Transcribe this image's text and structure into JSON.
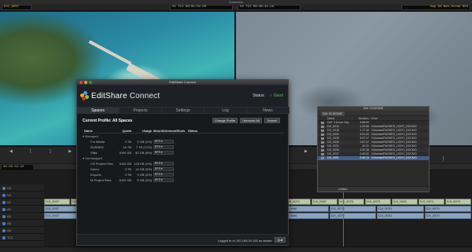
{
  "composer": {
    "title": "Composer",
    "clip_left": "DJI_0037",
    "tc_left": "V1  TC1     00:01:51:00",
    "tc_right": "V2  TC1     00:36:41:18",
    "clip_right": "Day 04 Ben Drone 004"
  },
  "timeline": {
    "timecode": "00:00:02:22",
    "tracks": [
      "V3",
      "V2",
      "V1",
      "A1",
      "A2",
      "A3",
      "A4",
      "TC1"
    ],
    "video_clips": [
      "DJI_0037",
      "DJI_0037",
      "DJI_0037",
      "DJI_0061",
      "DJI_0069",
      "DJI_0071",
      "DJI_0069",
      "DJI_0073",
      "DJI_0066",
      "DJI_0071",
      "DJI_0067",
      "DJI_0075",
      "DJI_0073",
      "DJI_0031",
      "DJI_0071",
      "DJI_0070"
    ],
    "audio_clips": [
      "DJI_0037",
      "DJI_0069",
      "DJI_0071",
      "DJI_0069",
      "DJI_0073",
      "DJI_0066",
      "DJI_0075",
      "DJI_0031",
      "DJI_0070"
    ],
    "footer_label": "untitled"
  },
  "dialog": {
    "title": "EditShare Connect",
    "logo_a": "EditShare",
    "logo_b": " Connect",
    "status_label": "Status:",
    "status_value": "✓ Good",
    "tabs": [
      "Spaces",
      "Projects",
      "Settings",
      "Log",
      "News"
    ],
    "profile_label": "Current Profile: All Spaces",
    "buttons": {
      "change_profile": "Change Profile",
      "unmount_all": "Unmount All",
      "search": "Search"
    },
    "columns": [
      "Name",
      "Quota",
      "Usage",
      "Mount/Unmount",
      "Tools",
      "Status"
    ],
    "groups": {
      "managed": "Managed",
      "unmanaged": "Unmanaged"
    },
    "managed_rows": [
      {
        "name": "For Media",
        "quota": "3 TB",
        "usage": "2 GB (0%)",
        "mount": "EFS"
      },
      {
        "name": "RUSHES",
        "quota": "16 TB",
        "usage": "7 TB (71%)",
        "mount": "EFS"
      },
      {
        "name": "Stills",
        "quota": "1000 GB",
        "usage": "82 GB (8%)",
        "mount": "EFS"
      }
    ],
    "unmanaged_rows": [
      {
        "name": "CS Project Files",
        "quota": "1000 GB",
        "usage": "128 KB (0%)",
        "mount": "EFS"
      },
      {
        "name": "Demo",
        "quota": "3 TB",
        "usage": "14 GB (0%)",
        "mount": "EFS"
      },
      {
        "name": "Exports",
        "quota": "3 TB",
        "usage": "9 GB (0%)",
        "mount": "EFS"
      },
      {
        "name": "M Project Files",
        "quota": "1000 GB",
        "usage": "9 GB (0%)",
        "mount": "EFS"
      }
    ],
    "login_text": "Logged in to 192.168.20.100 as xsuser",
    "quit_label": "Quit"
  },
  "bin": {
    "title": "DAY 03 DRONE",
    "tab_label": "DAY 03 DRONE",
    "columns": [
      "Name",
      "Duration",
      "Drive"
    ],
    "rows": [
      {
        "name": "DAY 3 Drone Seq",
        "duration": "4:58:05",
        "drive": ""
      },
      {
        "name": "DJI_0010",
        "duration": "1:20:08",
        "drive": "/Volumes/RUSHES_LIGHT_DOCMO"
      },
      {
        "name": "DJI_0018",
        "duration": "1:17:16",
        "drive": "/Volumes/RUSHES_LIGHT_DOCMO"
      },
      {
        "name": "DJI_0020",
        "duration": "3:51:00",
        "drive": "/Volumes/RUSHES_LIGHT_DOCMO"
      },
      {
        "name": "DJI_0028",
        "duration": "3:07:17",
        "drive": "/Volumes/RUSHES_LIGHT_DOCMO"
      },
      {
        "name": "DJI_0030",
        "duration": "1:57:17",
        "drive": "/Volumes/RUSHES_LIGHT_DOCMO"
      },
      {
        "name": "DJI_0031",
        "duration": "40:11",
        "drive": "/Volumes/RUSHES_LIGHT_DOCMO"
      },
      {
        "name": "DJI_0036",
        "duration": "1:22:15",
        "drive": "/Volumes/RUSHES_LIGHT_DOCMO"
      },
      {
        "name": "DJI_0037",
        "duration": "0:49:02",
        "drive": "/Volumes/RUSHES_LIGHT_DOCMO"
      },
      {
        "name": "DJI_0051",
        "duration": "0:40:13",
        "drive": "/Volumes/RUSHES_LIGHT_DOCMO"
      }
    ],
    "footer_label": "untitled"
  },
  "colors": {
    "accent": "#3b6fd6",
    "status_good": "#4ccf4c",
    "clip_yellow": "#e8c84a"
  }
}
